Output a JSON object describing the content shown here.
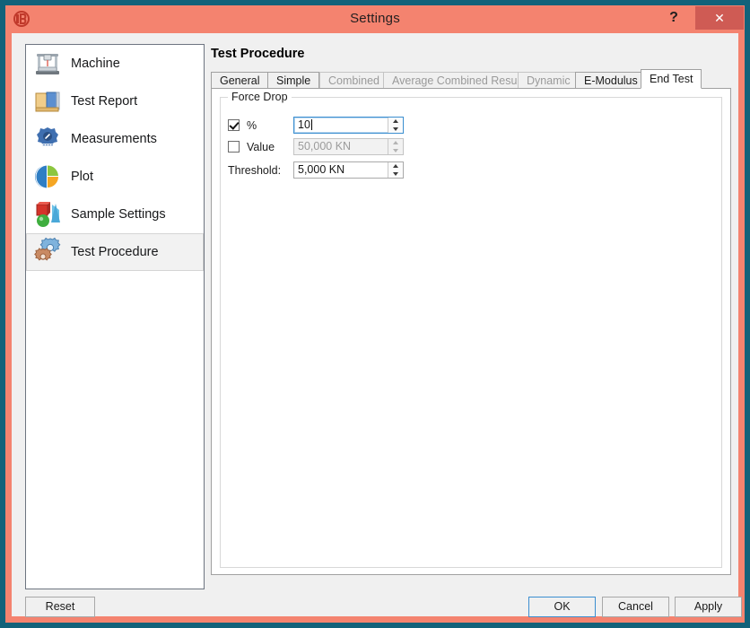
{
  "window": {
    "title": "Settings",
    "logo_icon": "app-logo-icon",
    "help_label": "?",
    "close_label": "✕"
  },
  "sidebar": {
    "items": [
      {
        "label": "Machine",
        "icon": "machine-icon",
        "selected": false
      },
      {
        "label": "Test Report",
        "icon": "report-icon",
        "selected": false
      },
      {
        "label": "Measurements",
        "icon": "measurements-icon",
        "selected": false
      },
      {
        "label": "Plot",
        "icon": "piechart-icon",
        "selected": false
      },
      {
        "label": "Sample Settings",
        "icon": "shapes-icon",
        "selected": false
      },
      {
        "label": "Test Procedure",
        "icon": "gears-icon",
        "selected": true
      }
    ]
  },
  "main": {
    "page_title": "Test Procedure",
    "tabs": [
      {
        "label": "General",
        "state": "enabled"
      },
      {
        "label": "Simple",
        "state": "enabled"
      },
      {
        "label": "Combined",
        "state": "disabled"
      },
      {
        "label": "Average Combined Results",
        "state": "disabled"
      },
      {
        "label": "Dynamic",
        "state": "disabled"
      },
      {
        "label": "E-Modulus",
        "state": "enabled"
      },
      {
        "label": "End Test",
        "state": "active"
      }
    ],
    "group": {
      "legend": "Force Drop",
      "percent": {
        "checkbox_label": "%",
        "checked": true,
        "value": "10",
        "enabled": true
      },
      "value": {
        "checkbox_label": "Value",
        "checked": false,
        "value": "50,000 KN",
        "enabled": false
      },
      "threshold": {
        "label": "Threshold:",
        "value": "5,000 KN",
        "enabled": true
      }
    }
  },
  "footer": {
    "reset_label": "Reset",
    "ok_label": "OK",
    "cancel_label": "Cancel",
    "apply_label": "Apply"
  },
  "colors": {
    "titlebar": "#f4836f",
    "close_button": "#cf5b54",
    "desktop": "#12627a",
    "focus_border": "#3b8ed0",
    "disabled_text": "#9a9a9a"
  }
}
